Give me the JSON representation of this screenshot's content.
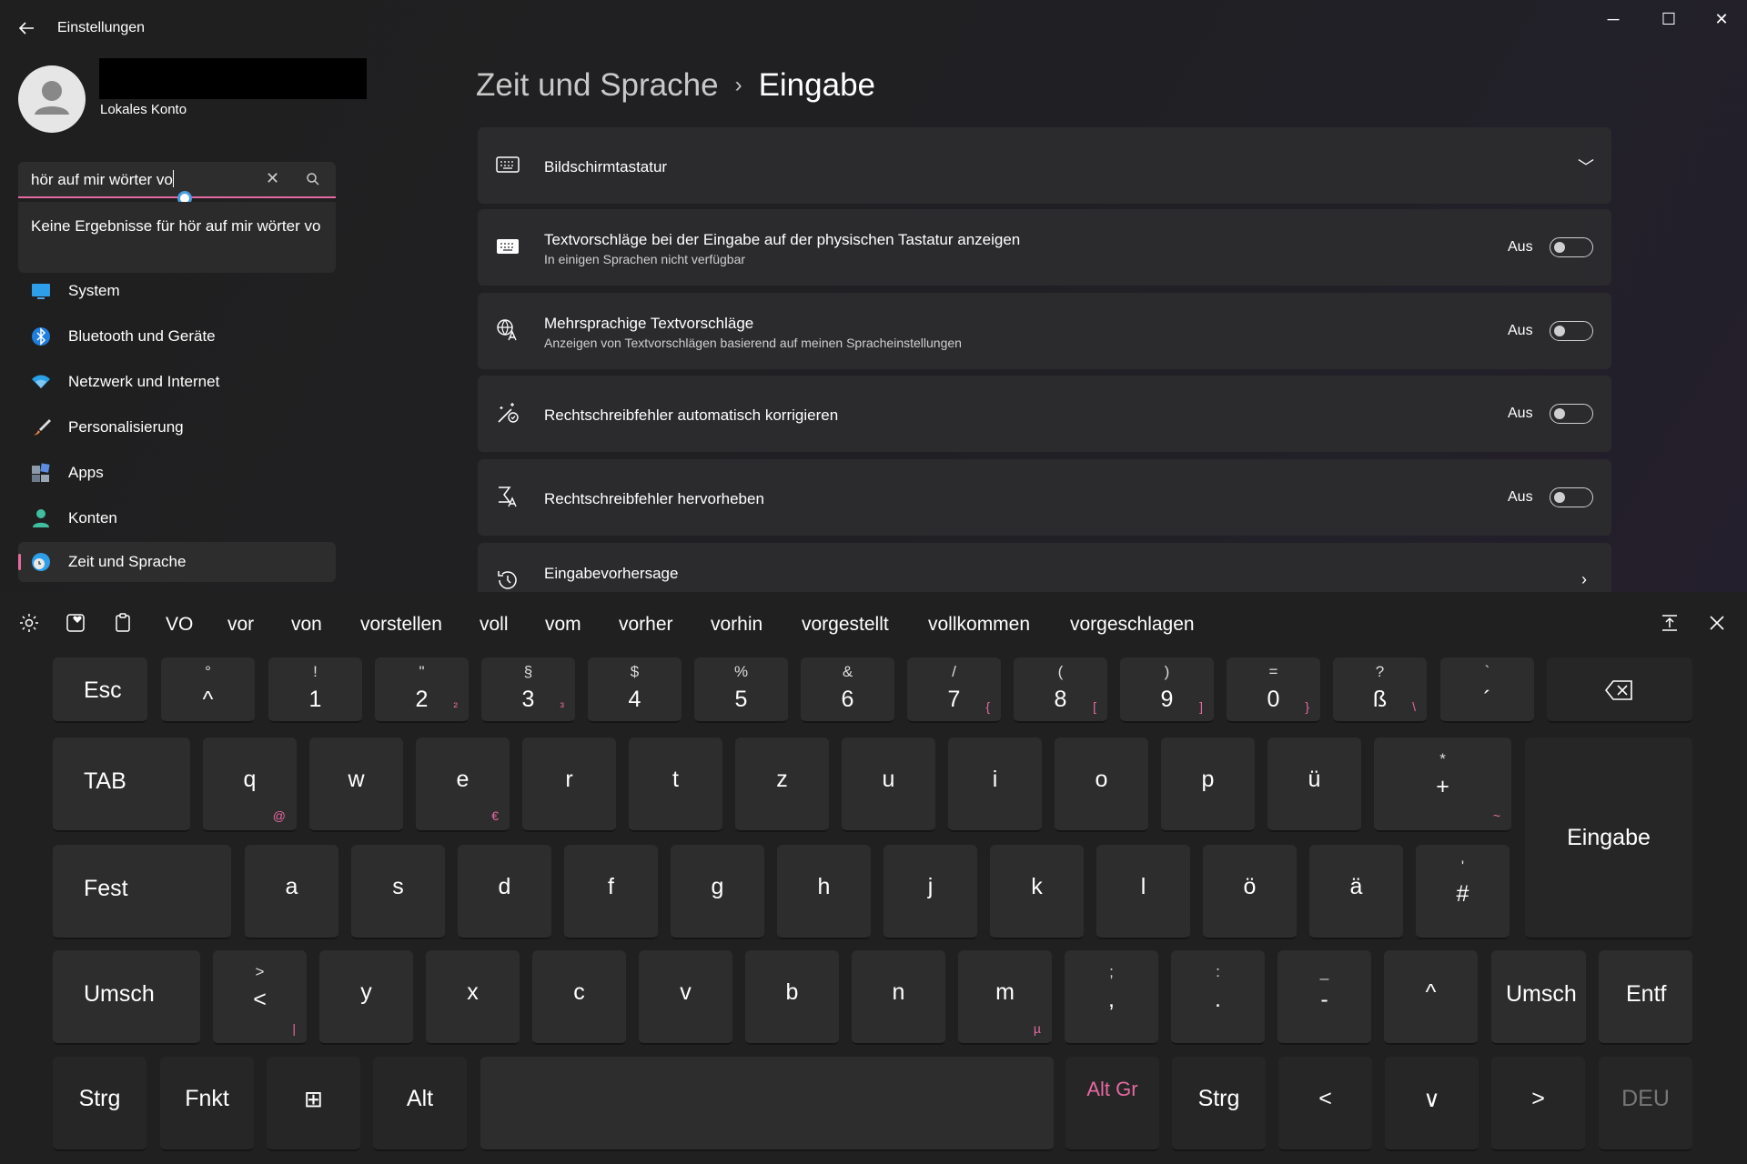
{
  "window": {
    "title": "Einstellungen",
    "controls": [
      "─",
      "☐",
      "✕"
    ]
  },
  "account": {
    "type": "Lokales Konto"
  },
  "search": {
    "value": "hör auf mir wörter vo",
    "no_results": "Keine Ergebnisse für hör auf mir wörter vo"
  },
  "nav": [
    {
      "label": "System"
    },
    {
      "label": "Bluetooth und Geräte"
    },
    {
      "label": "Netzwerk und Internet"
    },
    {
      "label": "Personalisierung"
    },
    {
      "label": "Apps"
    },
    {
      "label": "Konten"
    },
    {
      "label": "Zeit und Sprache"
    }
  ],
  "page": {
    "breadcrumb": "Zeit und Sprache",
    "separator": "›",
    "title": "Eingabe"
  },
  "settings": [
    {
      "title": "Bildschirmtastatur",
      "icon": "keyboard-icon"
    },
    {
      "title": "Textvorschläge bei der Eingabe auf der physischen Tastatur anzeigen",
      "subtitle": "In einigen Sprachen nicht verfügbar",
      "state": "Aus",
      "icon": "keyboard-filled-icon"
    },
    {
      "title": "Mehrsprachige Textvorschläge",
      "subtitle": "Anzeigen von Textvorschlägen basierend auf meinen Spracheinstellungen",
      "state": "Aus",
      "icon": "language-icon"
    },
    {
      "title": "Rechtschreibfehler automatisch korrigieren",
      "state": "Aus",
      "icon": "autocorrect-icon"
    },
    {
      "title": "Rechtschreibfehler hervorheben",
      "state": "Aus",
      "icon": "spellcheck-icon"
    },
    {
      "title": "Eingabevorhersage",
      "icon": "history-icon"
    }
  ],
  "keyboard": {
    "suggestions": [
      "VO",
      "vor",
      "von",
      "vorstellen",
      "voll",
      "vom",
      "vorher",
      "vorhin",
      "vorgestellt",
      "vollkommen",
      "vorgeschlagen"
    ],
    "row1": [
      {
        "main": "Esc"
      },
      {
        "main": "^",
        "shift": "°"
      },
      {
        "main": "1",
        "shift": "!"
      },
      {
        "main": "2",
        "shift": "\"",
        "alt": "²"
      },
      {
        "main": "3",
        "shift": "§",
        "alt": "³"
      },
      {
        "main": "4",
        "shift": "$"
      },
      {
        "main": "5",
        "shift": "%"
      },
      {
        "main": "6",
        "shift": "&"
      },
      {
        "main": "7",
        "shift": "/",
        "alt": "{"
      },
      {
        "main": "8",
        "shift": "(",
        "alt": "["
      },
      {
        "main": "9",
        "shift": ")",
        "alt": "]"
      },
      {
        "main": "0",
        "shift": "=",
        "alt": "}"
      },
      {
        "main": "ß",
        "shift": "?",
        "alt": "\\"
      },
      {
        "main": "´",
        "shift": "`"
      }
    ],
    "row2": [
      {
        "main": "TAB"
      },
      {
        "main": "q",
        "alt": "@"
      },
      {
        "main": "w"
      },
      {
        "main": "e",
        "alt": "€"
      },
      {
        "main": "r"
      },
      {
        "main": "t"
      },
      {
        "main": "z"
      },
      {
        "main": "u"
      },
      {
        "main": "i"
      },
      {
        "main": "o"
      },
      {
        "main": "p"
      },
      {
        "main": "ü"
      },
      {
        "main": "+",
        "shift": "*",
        "alt": "~"
      }
    ],
    "enter": "Eingabe",
    "row3": [
      {
        "main": "Fest"
      },
      {
        "main": "a"
      },
      {
        "main": "s"
      },
      {
        "main": "d"
      },
      {
        "main": "f"
      },
      {
        "main": "g"
      },
      {
        "main": "h"
      },
      {
        "main": "j"
      },
      {
        "main": "k"
      },
      {
        "main": "l"
      },
      {
        "main": "ö"
      },
      {
        "main": "ä"
      },
      {
        "main": "#",
        "shift": "'"
      }
    ],
    "row4": [
      {
        "main": "Umsch"
      },
      {
        "main": "<",
        "shift": ">",
        "alt": "|"
      },
      {
        "main": "y"
      },
      {
        "main": "x"
      },
      {
        "main": "c"
      },
      {
        "main": "v"
      },
      {
        "main": "b"
      },
      {
        "main": "n"
      },
      {
        "main": "m",
        "alt": "µ"
      },
      {
        "main": ",",
        "shift": ";"
      },
      {
        "main": ".",
        "shift": ":"
      },
      {
        "main": "-",
        "shift": "_"
      },
      {
        "main": "^"
      },
      {
        "main": "Umsch"
      },
      {
        "main": "Entf"
      }
    ],
    "row5": [
      {
        "main": "Strg"
      },
      {
        "main": "Fnkt"
      },
      {
        "main": "⊞"
      },
      {
        "main": "Alt"
      },
      {
        "main": ""
      },
      {
        "main": "Alt Gr"
      },
      {
        "main": "Strg"
      },
      {
        "main": "<"
      },
      {
        "main": "∨"
      },
      {
        "main": ">"
      },
      {
        "main": "DEU"
      }
    ],
    "colors": {
      "accent": "#e56aa1",
      "key": "#2d2d2d",
      "bg": "#202020"
    }
  }
}
